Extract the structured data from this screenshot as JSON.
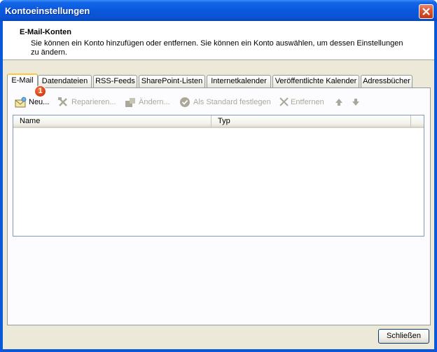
{
  "window": {
    "title": "Kontoeinstellungen"
  },
  "header": {
    "title": "E-Mail-Konten",
    "description": "Sie können ein Konto hinzufügen oder entfernen. Sie können ein Konto auswählen, um dessen Einstellungen zu ändern."
  },
  "tabs": [
    {
      "label": "E-Mail",
      "active": true
    },
    {
      "label": "Datendateien",
      "active": false
    },
    {
      "label": "RSS-Feeds",
      "active": false
    },
    {
      "label": "SharePoint-Listen",
      "active": false
    },
    {
      "label": "Internetkalender",
      "active": false
    },
    {
      "label": "Veröffentlichte Kalender",
      "active": false
    },
    {
      "label": "Adressbücher",
      "active": false
    }
  ],
  "toolbar": {
    "new_label": "Neu...",
    "repair_label": "Reparieren...",
    "change_label": "Ändern...",
    "set_default_label": "Als Standard festlegen",
    "remove_label": "Entfernen",
    "move_up_icon": "arrow-up-icon",
    "move_down_icon": "arrow-down-icon"
  },
  "callout": {
    "number": "1"
  },
  "list": {
    "columns": [
      "Name",
      "Typ"
    ],
    "rows": []
  },
  "footer": {
    "close_label": "Schließen"
  },
  "colors": {
    "titlebar": "#0a58dc",
    "dialog_bg": "#ece9d8",
    "active_tab_accent": "#ffc83c",
    "badge": "#d9441a",
    "close_button": "#d9542f"
  }
}
